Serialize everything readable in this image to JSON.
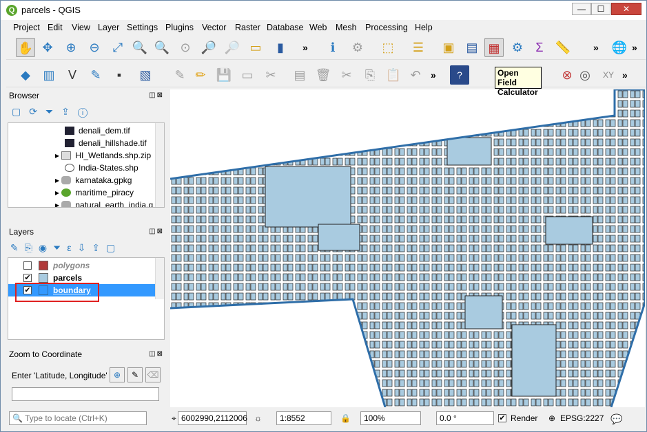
{
  "window": {
    "title": "parcels - QGIS",
    "minimize": "—",
    "maximize": "☐",
    "close": "✕",
    "app_icon": "Q"
  },
  "menu": [
    "Project",
    "Edit",
    "View",
    "Layer",
    "Settings",
    "Plugins",
    "Vector",
    "Raster",
    "Database",
    "Web",
    "Mesh",
    "Processing",
    "Help"
  ],
  "tooltip": {
    "line1": "Open Field",
    "line2": "Calculator"
  },
  "browser": {
    "title": "Browser",
    "items": [
      "denali_dem.tif",
      "denali_hillshade.tif",
      "HI_Wetlands.shp.zip",
      "India-States.shp",
      "karnataka.gpkg",
      "maritime_piracy",
      "natural_earth_india.g"
    ]
  },
  "layers": {
    "title": "Layers",
    "items": [
      {
        "name": "polygons",
        "checked": false,
        "color": "#b03a3a"
      },
      {
        "name": "parcels",
        "checked": true,
        "color": "#a9cbe0"
      },
      {
        "name": "boundary",
        "checked": true,
        "color": "#2f6ea8"
      }
    ]
  },
  "zoom": {
    "title": "Zoom to Coordinate",
    "label": "Enter 'Latitude, Longitude'",
    "value": ""
  },
  "status": {
    "locate_placeholder": "Type to locate (Ctrl+K)",
    "coordinate": "6002990,2112006",
    "scale": "1:8552",
    "magnifier": "100%",
    "rotation": "0.0 °",
    "render": "Render",
    "crs": "EPSG:2227"
  },
  "colors": {
    "parcel_fill": "#a9cbe0",
    "boundary": "#2f6ea8",
    "selection": "#3399ff"
  }
}
